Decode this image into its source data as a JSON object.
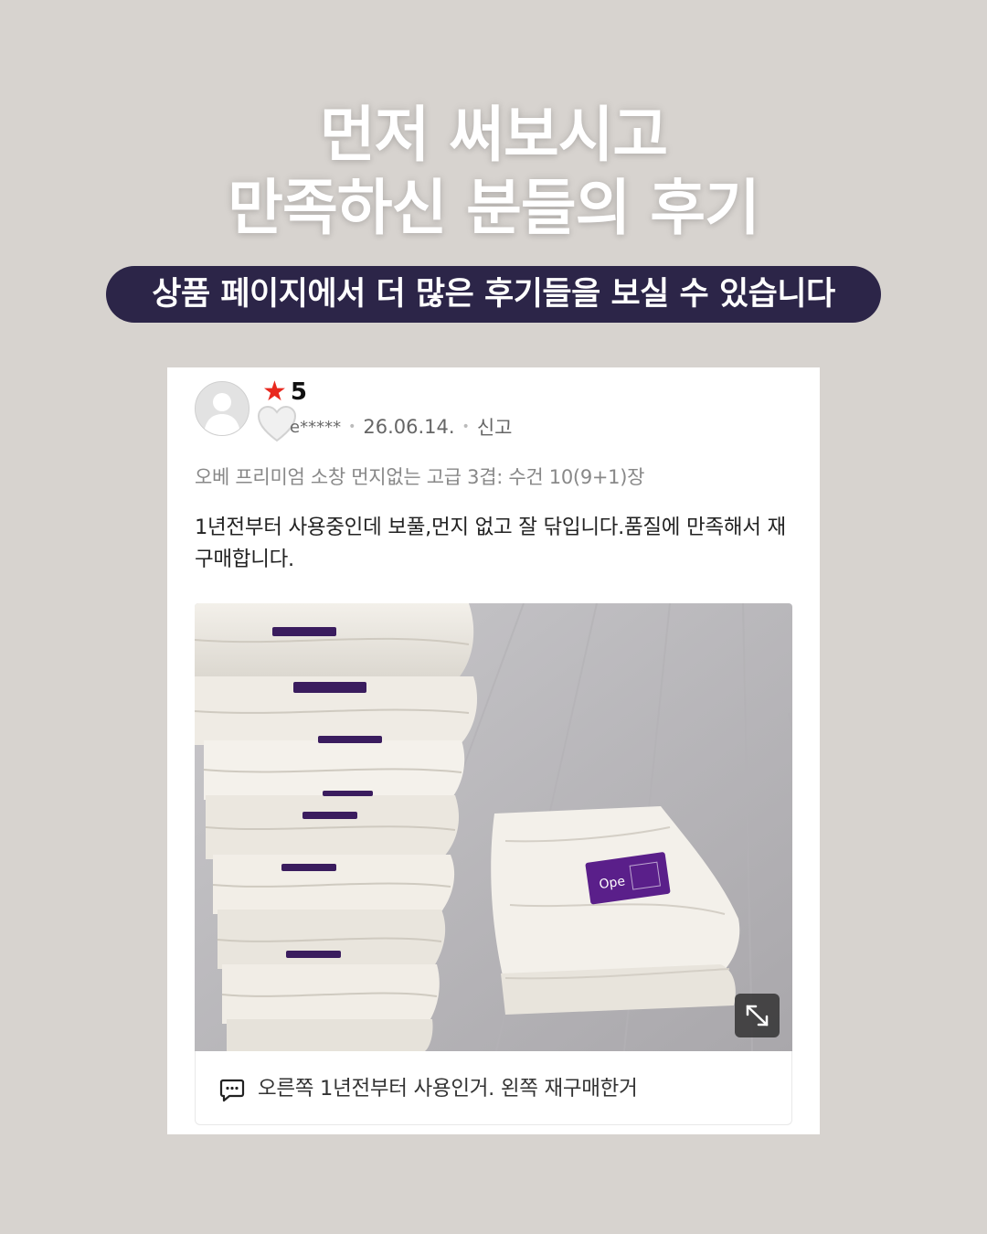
{
  "headline": {
    "line1": "먼저 써보시고",
    "line2": "만족하신 분들의 후기"
  },
  "banner": {
    "text": "상품 페이지에서 더 많은 후기들을 보실 수 있습니다"
  },
  "review": {
    "rating": "5",
    "username": "e*****",
    "date": "26.06.14.",
    "report_label": "신고",
    "product_name": "오베 프리미엄 소창 먼지없는 고급 3겹: 수건 10(9+1)장",
    "body": "1년전부터 사용중인데  보풀,먼지 없고  잘 닦입니다.품질에  만족해서 재구매합니다.",
    "comment": "오른쪽 1년전부터 사용인거. 왼쪽 재구매한거"
  },
  "colors": {
    "background": "#d7d3cf",
    "banner_bg": "#2c2548",
    "star": "#e8281e",
    "label_purple": "#5a1f8a"
  },
  "icons": [
    "avatar-placeholder-icon",
    "star-icon",
    "heart-icon",
    "expand-icon",
    "chat-bubble-icon"
  ]
}
